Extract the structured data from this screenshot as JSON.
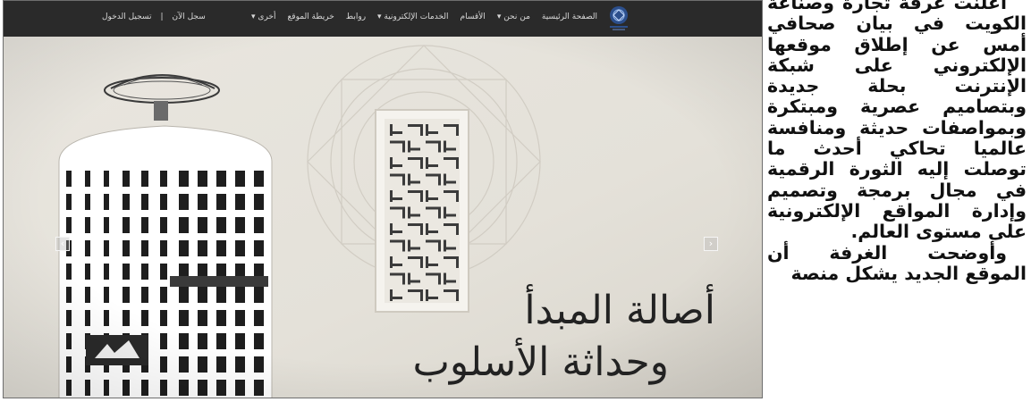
{
  "navbar": {
    "menu": [
      "الصفحة الرئيسية",
      "من نحن ▾",
      "الأقسام",
      "الخدمات الإلكترونية ▾",
      "روابط",
      "خريطة الموقع",
      "أخرى ▾"
    ],
    "user_links": [
      "سجل الآن",
      "|",
      "تسجيل الدخول"
    ]
  },
  "hero": {
    "slogan_line1": "أصالة المبدأ",
    "slogan_line2": "وحداثة الأسلوب",
    "prev_arrow": "‹",
    "next_arrow": "›"
  },
  "article": {
    "paragraph1": "أعلنت غرفة تجارة وصناعة الكويت في بيان صحافي أمس عن إطلاق موقعها الإلكتروني على شبكة الإنترنت بحلة جديدة وبتصاميم عصرية ومبتكرة وبمواصفات حديثة ومنافسة عالميا تحاكي أحدث ما توصلت إليه الثورة الرقمية في مجال برمجة وتصميم وإدارة المواقع الإلكترونية على مستوى العالم.",
    "paragraph2": "وأوضحت الغرفة أن الموقع الجديد يشكل منصة"
  },
  "colors": {
    "navbar_bg": "#2a2a2a",
    "hero_bg": "#e8e5de",
    "logo_blue": "#2c4f8c"
  }
}
